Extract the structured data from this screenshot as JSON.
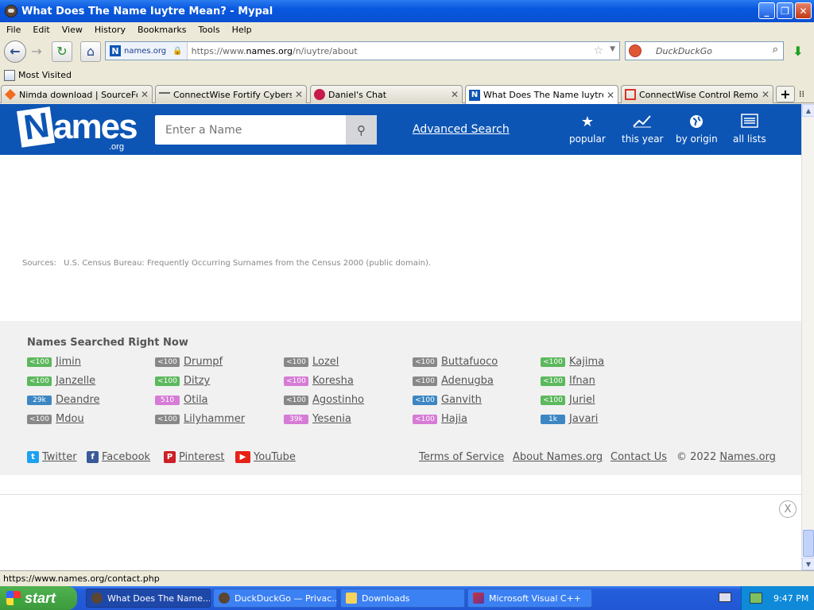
{
  "window": {
    "title": "What Does The Name Iuytre Mean? - Mypal",
    "controls": {
      "minimize": "_",
      "maximize": "❐",
      "close": "✕"
    }
  },
  "menu": [
    "File",
    "Edit",
    "View",
    "History",
    "Bookmarks",
    "Tools",
    "Help"
  ],
  "navbar": {
    "site_identity": "names.org",
    "url_prefix": "https://www.",
    "url_domain": "names.org",
    "url_path": "/n/iuytre/about",
    "search_placeholder": "DuckDuckGo"
  },
  "bookmarks": {
    "most_visited": "Most Visited"
  },
  "tabs": [
    {
      "label": "Nimda download | SourceFor...",
      "color": "#f26b21"
    },
    {
      "label": "ConnectWise Fortify Cyberse...",
      "color": "#666666"
    },
    {
      "label": "Daniel's Chat",
      "color": "#c51a4a"
    },
    {
      "label": "What Does The Name Iuytre ...",
      "color": "#0d55b5",
      "active": true
    },
    {
      "label": "ConnectWise Control Remote...",
      "color": "#d9342b"
    }
  ],
  "site": {
    "logo": "Names",
    "logo_sub": ".org",
    "search_placeholder": "Enter a Name",
    "advanced_search": "Advanced Search",
    "nav": [
      {
        "label": "popular",
        "icon": "star-icon"
      },
      {
        "label": "this year",
        "icon": "trend-icon"
      },
      {
        "label": "by origin",
        "icon": "globe-icon"
      },
      {
        "label": "all lists",
        "icon": "list-icon"
      }
    ]
  },
  "sources": {
    "label": "Sources:",
    "text": "U.S. Census Bureau: Frequently Occurring Surnames from the Census 2000 (public domain)."
  },
  "right_now": {
    "title": "Names Searched Right Now",
    "columns": [
      [
        {
          "badge": "<100",
          "color": "#5cb85c",
          "name": "Jimin"
        },
        {
          "badge": "<100",
          "color": "#5cb85c",
          "name": "Janzelle"
        },
        {
          "badge": "29k",
          "color": "#3d86c4",
          "name": "Deandre"
        },
        {
          "badge": "<100",
          "color": "#888888",
          "name": "Mdou"
        }
      ],
      [
        {
          "badge": "<100",
          "color": "#888888",
          "name": "Drumpf"
        },
        {
          "badge": "<100",
          "color": "#5cb85c",
          "name": "Ditzy"
        },
        {
          "badge": "510",
          "color": "#d67bd6",
          "name": "Otila"
        },
        {
          "badge": "<100",
          "color": "#888888",
          "name": "Lilyhammer"
        }
      ],
      [
        {
          "badge": "<100",
          "color": "#888888",
          "name": "Lozel"
        },
        {
          "badge": "<100",
          "color": "#d67bd6",
          "name": "Koresha"
        },
        {
          "badge": "<100",
          "color": "#888888",
          "name": "Agostinho"
        },
        {
          "badge": "39k",
          "color": "#d67bd6",
          "name": "Yesenia"
        }
      ],
      [
        {
          "badge": "<100",
          "color": "#888888",
          "name": "Buttafuoco"
        },
        {
          "badge": "<100",
          "color": "#888888",
          "name": "Adenugba"
        },
        {
          "badge": "<100",
          "color": "#3d86c4",
          "name": "Ganvith"
        },
        {
          "badge": "<100",
          "color": "#d67bd6",
          "name": "Hajia"
        }
      ],
      [
        {
          "badge": "<100",
          "color": "#5cb85c",
          "name": "Kajima"
        },
        {
          "badge": "<100",
          "color": "#5cb85c",
          "name": "Ifnan"
        },
        {
          "badge": "<100",
          "color": "#5cb85c",
          "name": "Juriel"
        },
        {
          "badge": "1k",
          "color": "#3d86c4",
          "name": "Javari"
        }
      ]
    ]
  },
  "footer": {
    "social": [
      {
        "label": "Twitter",
        "color": "#1da1f2",
        "icon": "twitter-icon"
      },
      {
        "label": "Facebook",
        "color": "#3b5998",
        "icon": "facebook-icon"
      },
      {
        "label": "Pinterest",
        "color": "#cb2027",
        "icon": "pinterest-icon"
      },
      {
        "label": "YouTube",
        "color": "#e62117",
        "icon": "youtube-icon"
      }
    ],
    "links": [
      "Terms of Service",
      "About Names.org",
      "Contact Us"
    ],
    "copyright": "© 2022",
    "copyright_link": "Names.org"
  },
  "ad_close": "X",
  "status_url": "https://www.names.org/contact.php",
  "taskbar": {
    "start": "start",
    "items": [
      {
        "label": "What Does The Name...",
        "active": true
      },
      {
        "label": "DuckDuckGo — Privac...",
        "active": false
      },
      {
        "label": "Downloads",
        "active": false
      },
      {
        "label": "Microsoft Visual C++",
        "active": false
      }
    ],
    "clock": "9:47 PM"
  }
}
